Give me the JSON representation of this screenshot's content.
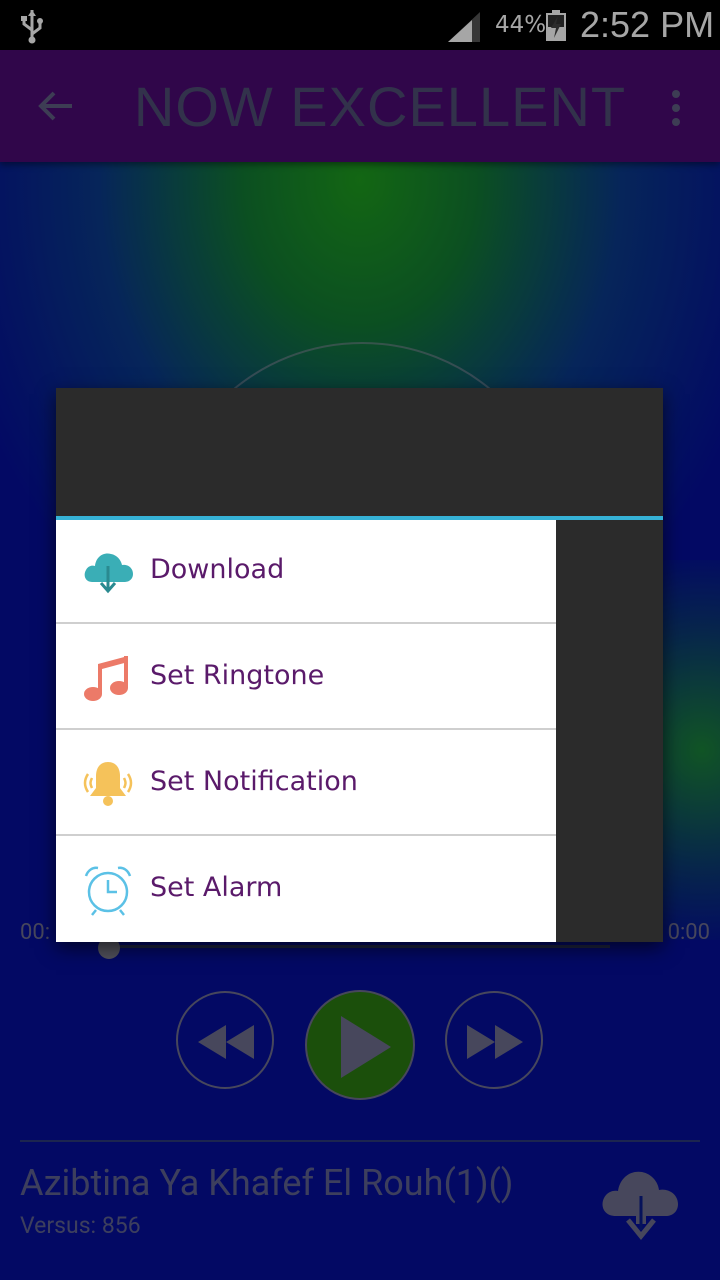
{
  "status_bar": {
    "battery_percent": "44%",
    "time": "2:52 PM"
  },
  "app_bar": {
    "title": "NOW EXCELLENT"
  },
  "player": {
    "time_elapsed": "00:",
    "time_total": "0:00",
    "track_title": "Azibtina Ya Khafef El Rouh(1)()",
    "track_subtitle": "Versus: 856"
  },
  "dialog": {
    "items": [
      {
        "label": "Download",
        "icon": "cloud-download-icon",
        "color": "#3aaeb6"
      },
      {
        "label": "Set Ringtone",
        "icon": "music-note-icon",
        "color": "#ec7a68"
      },
      {
        "label": "Set Notification",
        "icon": "bell-icon",
        "color": "#f5c25a"
      },
      {
        "label": "Set Alarm",
        "icon": "alarm-clock-icon",
        "color": "#5bc1e6"
      }
    ],
    "accent_color": "#36b2d6"
  },
  "colors": {
    "app_bar": "#4a0a72",
    "play_button": "#2a7a12"
  }
}
